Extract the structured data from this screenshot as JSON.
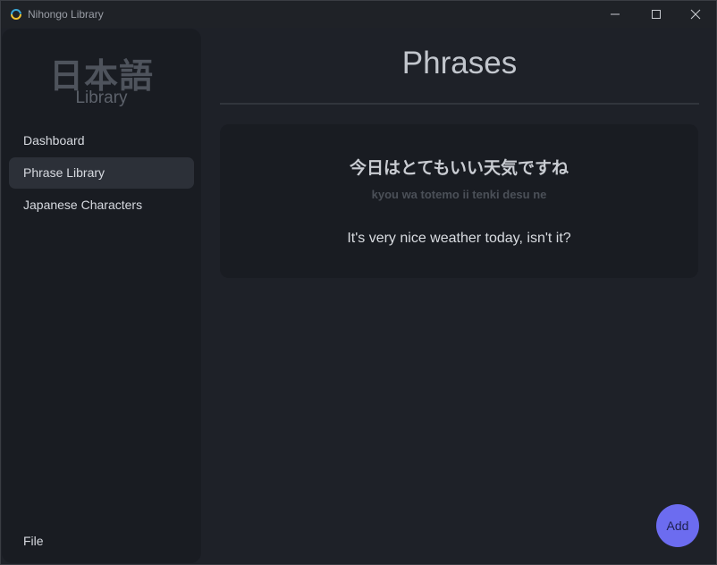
{
  "window": {
    "title": "Nihongo Library",
    "controls": [
      "minimize-icon",
      "maximize-icon",
      "close-icon"
    ]
  },
  "sidebar": {
    "brand_title": "日本語",
    "brand_subtitle": "Library",
    "items": [
      {
        "label": "Dashboard",
        "active": false
      },
      {
        "label": "Phrase Library",
        "active": true
      },
      {
        "label": "Japanese Characters",
        "active": false
      }
    ],
    "footer_item": {
      "label": "File"
    }
  },
  "main": {
    "title": "Phrases",
    "phrases": [
      {
        "japanese": "今日はとてもいい天気ですね",
        "romaji": "kyou wa totemo ii tenki desu ne",
        "english": "It's very nice weather today, isn't it?"
      }
    ],
    "add_button": "Add"
  },
  "colors": {
    "background": "#1e2128",
    "sidebar": "#191c22",
    "active_item": "#2c3038",
    "accent": "#6c6cf0"
  }
}
